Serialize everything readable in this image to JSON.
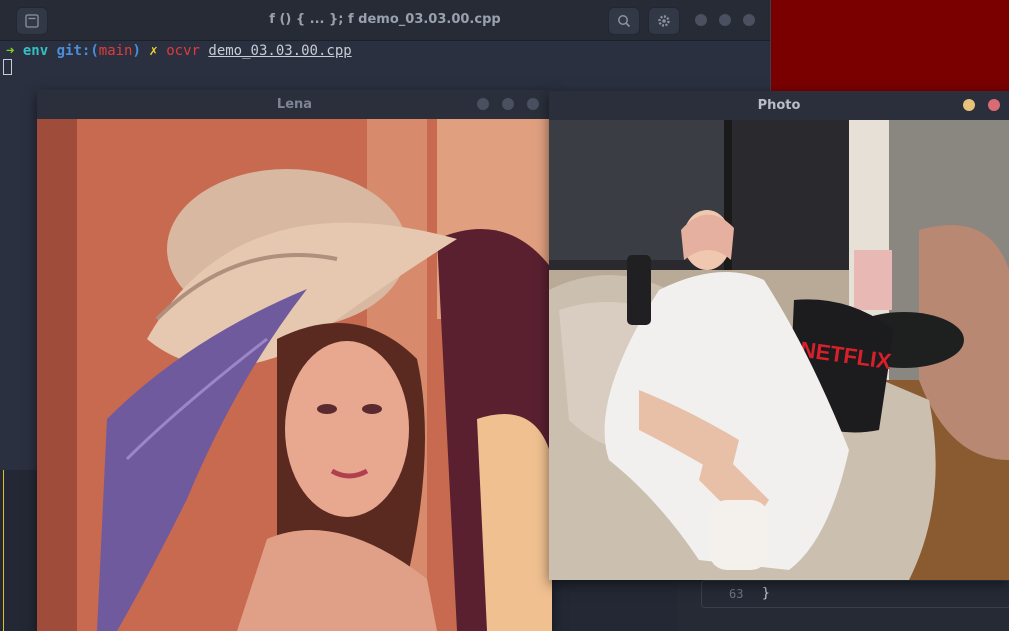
{
  "terminal": {
    "title": "f () { ... }; f demo_03.03.00.cpp",
    "prompt": {
      "arrow": "➜",
      "env": "env",
      "git_prefix": "git:(",
      "branch": "main",
      "git_suffix": ")",
      "dirty_mark": "✗",
      "command": "ocvr",
      "file": "demo_03.03.00.cpp"
    },
    "editor": {
      "line_number": "63",
      "code": "}"
    }
  },
  "lena_window": {
    "title": "Lena"
  },
  "photo_window": {
    "title": "Photo",
    "pillow_text": "NETFLIX"
  },
  "colors": {
    "desktop_bg": "#7a0000",
    "terminal_bg": "#2b3040",
    "close_dot": "#d96b75",
    "minimize_dot": "#e8c27a"
  },
  "icons": [
    "menu-icon",
    "search-icon",
    "gear-icon"
  ]
}
